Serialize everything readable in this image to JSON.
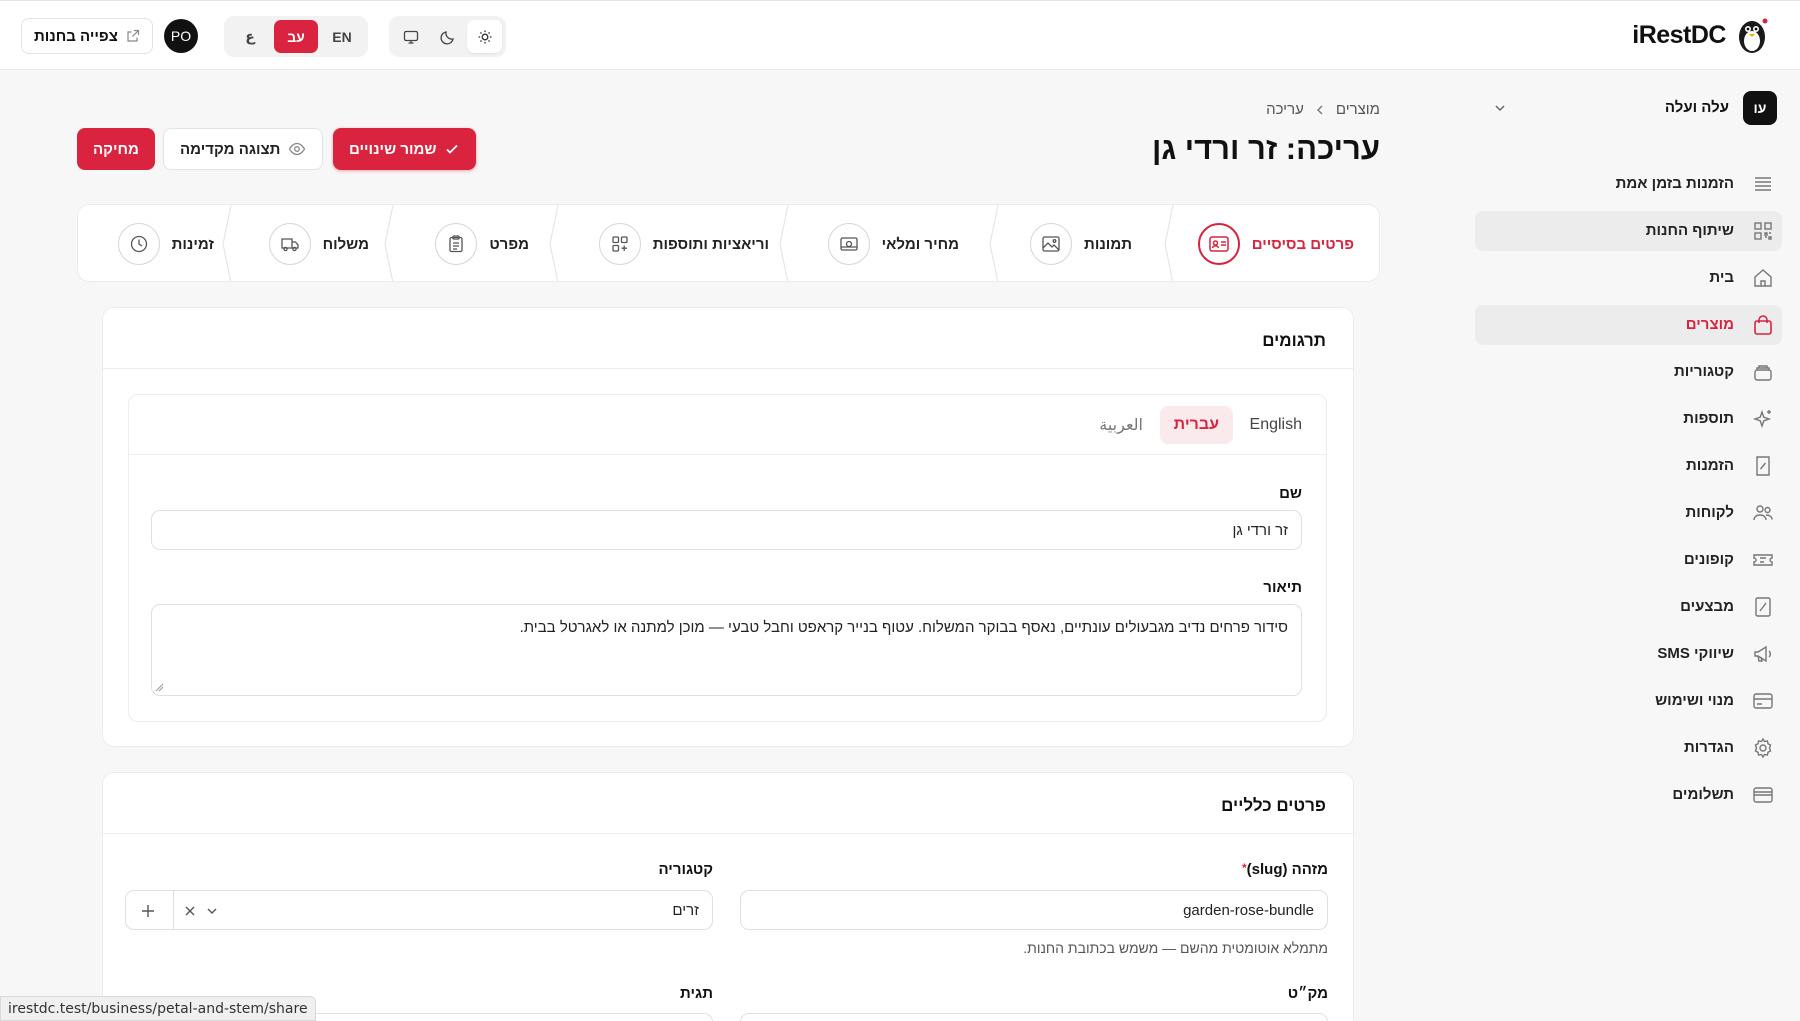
{
  "brand": {
    "name": "iRestDC"
  },
  "topbar": {
    "store_view_label": "צפייה בחנות",
    "user_initials": "PO",
    "languages": [
      {
        "code": "ar",
        "label": "ع"
      },
      {
        "code": "he",
        "label": "עב"
      },
      {
        "code": "en",
        "label": "EN"
      }
    ],
    "active_language": "he",
    "theme_options": [
      "monitor-icon",
      "moon-icon",
      "sun-icon"
    ],
    "active_theme": "sun-icon"
  },
  "account": {
    "initials": "עו",
    "name": "עלה ועלה"
  },
  "sidebar": {
    "items": [
      {
        "id": "live-orders",
        "label": "הזמנות בזמן אמת",
        "icon": "list-icon"
      },
      {
        "id": "share-store",
        "label": "שיתוף החנות",
        "icon": "qr-icon"
      },
      {
        "id": "home",
        "label": "בית",
        "icon": "home-icon"
      },
      {
        "id": "products",
        "label": "מוצרים",
        "icon": "bag-icon"
      },
      {
        "id": "categories",
        "label": "קטגוריות",
        "icon": "layers-icon"
      },
      {
        "id": "addons",
        "label": "תוספות",
        "icon": "sparkle-icon"
      },
      {
        "id": "orders",
        "label": "הזמנות",
        "icon": "receipt-icon"
      },
      {
        "id": "customers",
        "label": "לקוחות",
        "icon": "users-icon"
      },
      {
        "id": "coupons",
        "label": "קופונים",
        "icon": "ticket-icon"
      },
      {
        "id": "promotions",
        "label": "מבצעים",
        "icon": "percent-icon"
      },
      {
        "id": "sms",
        "label": "SMS שיווקי",
        "icon": "megaphone-icon"
      },
      {
        "id": "subscription",
        "label": "מנוי ושימוש",
        "icon": "card-icon"
      },
      {
        "id": "settings",
        "label": "הגדרות",
        "icon": "gear-icon"
      },
      {
        "id": "payments",
        "label": "תשלומים",
        "icon": "wallet-icon"
      }
    ],
    "active": "products",
    "hovered": "share-store"
  },
  "breadcrumb": {
    "parent": "מוצרים",
    "current": "עריכה"
  },
  "page": {
    "title": "עריכה: זר ורדי גן",
    "save_label": "שמור שינויים",
    "preview_label": "תצוגה מקדימה",
    "delete_label": "מחיקה"
  },
  "steps": [
    {
      "label": "פרטים בסיסיים",
      "icon": "id-card-icon",
      "active": true
    },
    {
      "label": "תמונות",
      "icon": "image-icon"
    },
    {
      "label": "מחיר ומלאי",
      "icon": "cash-icon"
    },
    {
      "label": "וריאציות ותוספות",
      "icon": "grid-plus-icon"
    },
    {
      "label": "מפרט",
      "icon": "clipboard-icon"
    },
    {
      "label": "משלוח",
      "icon": "truck-icon"
    },
    {
      "label": "זמינות",
      "icon": "clock-icon"
    }
  ],
  "translations": {
    "title": "תרגומים",
    "tabs": {
      "en": "English",
      "he": "עברית",
      "ar": "العربية"
    },
    "active_tab": "he",
    "name_label": "שם",
    "name_value": "זר ורדי גן",
    "description_label": "תיאור",
    "description_value": "סידור פרחים נדיב מגבעולים עונתיים, נאסף בבוקר המשלוח. עטוף בנייר קראפט וחבל טבעי — מוכן למתנה או לאגרטל בבית."
  },
  "general": {
    "title": "פרטים כלליים",
    "slug_label": "מזהה (slug)",
    "slug_required_mark": "*",
    "slug_value": "garden-rose-bundle",
    "slug_hint": "מתמלא אוטומטית מהשם — משמש בכתובת החנות.",
    "category_label": "קטגוריה",
    "category_value": "זרים",
    "sku_label": "מק״ט",
    "tag_label": "תגית"
  },
  "statusbar": {
    "url": "irestdc.test/business/petal-and-stem/share"
  },
  "colors": {
    "accent": "#d9233f",
    "background": "#f7f7f7",
    "surface": "#ffffff"
  }
}
